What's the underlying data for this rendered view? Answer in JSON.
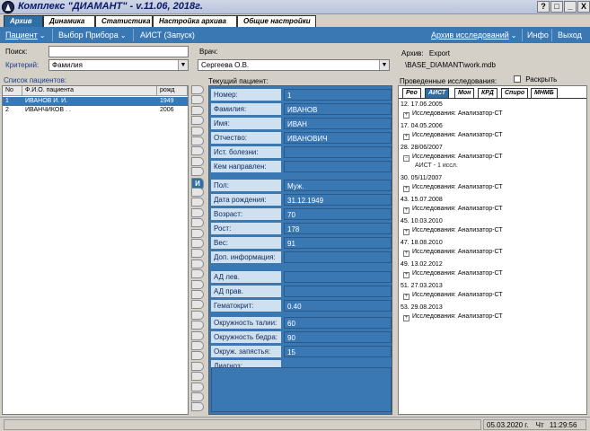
{
  "window": {
    "title": "Комплекс \"ДИАМАНТ\" - v.11.06, 2018г.",
    "buttons": [
      "?",
      "□",
      "_",
      "X"
    ]
  },
  "tabs": [
    {
      "label": "Архив",
      "active": true
    },
    {
      "label": "Динамика",
      "active": false
    },
    {
      "label": "Статистика",
      "active": false
    },
    {
      "label": "Настройка архива",
      "active": false
    },
    {
      "label": "Общие настройки",
      "active": false
    }
  ],
  "toolbar": {
    "patient_menu": "Пациент",
    "device_select": "Выбор Прибора",
    "aist_launch": "АИСТ (Запуск)",
    "archive_research": "Архив исследований",
    "info": "Инфо",
    "exit": "Выход"
  },
  "search": {
    "search_label": "Поиск:",
    "search_value": "",
    "criterion_label": "Критерий:",
    "criterion_value": "Фамилия",
    "doctor_label": "Врач:",
    "doctor_value": "Сергеева О.В.",
    "archive_label": "Архив:",
    "archive_name": "Export",
    "archive_path": "\\BASE_DIAMANT\\work.mdb"
  },
  "patients": {
    "section_label": "Список пациентов:",
    "columns": [
      "No",
      "Ф.И.О. пациента",
      "рожд"
    ],
    "rows": [
      {
        "no": "1",
        "name": "ИВАНОВ И. И.",
        "born": "1949",
        "selected": true
      },
      {
        "no": "2",
        "name": "ИВАНЧИКОВ . .",
        "born": "2006",
        "selected": false
      }
    ]
  },
  "alphabet": {
    "active_letter": "И"
  },
  "current_patient": {
    "section_label": "Текущий пациент:",
    "fields": [
      {
        "label": "Номер:",
        "value": "1"
      },
      {
        "label": "Фамилия:",
        "value": "ИВАНОВ"
      },
      {
        "label": "Имя:",
        "value": "ИВАН"
      },
      {
        "label": "Отчество:",
        "value": "ИВАНОВИЧ"
      },
      {
        "label": "Ист. болезни:",
        "value": ""
      },
      {
        "label": "Кем направлен:",
        "value": ""
      },
      {
        "label": "Пол:",
        "value": "Муж."
      },
      {
        "label": "Дата рождения:",
        "value": "31.12.1949"
      },
      {
        "label": "Возраст:",
        "value": "70"
      },
      {
        "label": "Рост:",
        "value": "178"
      },
      {
        "label": "Вес:",
        "value": "91"
      },
      {
        "label": "Доп. информация:",
        "value": ""
      },
      {
        "label": "АД лев.",
        "value": ""
      },
      {
        "label": "АД прав.",
        "value": ""
      },
      {
        "label": "Гематокрит:",
        "value": "0.40"
      },
      {
        "label": "Окружность талии:",
        "value": "60"
      },
      {
        "label": "Окружность бедра:",
        "value": "90"
      },
      {
        "label": "Окруж. запястья:",
        "value": "15"
      },
      {
        "label": "Диагноз:",
        "value": ""
      }
    ]
  },
  "research": {
    "section_label": "Проведенные исследования:",
    "expand_label": "Раскрыть",
    "tabs": [
      {
        "label": "Рео",
        "active": false
      },
      {
        "label": "АИСТ",
        "active": true
      },
      {
        "label": "Мон",
        "active": false
      },
      {
        "label": "КРД",
        "active": false
      },
      {
        "label": "Спиро",
        "active": false
      },
      {
        "label": "МНМБ",
        "active": false
      }
    ],
    "entries": [
      {
        "date": "12. 17.06.2005",
        "item": "Исследования: Анализатор-СТ",
        "sub": ""
      },
      {
        "date": "17. 04.05.2006",
        "item": "Исследования: Анализатор-СТ",
        "sub": ""
      },
      {
        "date": "28. 28/06/2007",
        "item": "Исследования: Анализатор-СТ",
        "sub": "АИСТ - 1 иссл."
      },
      {
        "date": "30. 05/11/2007",
        "item": "Исследования: Анализатор-СТ",
        "sub": ""
      },
      {
        "date": "43. 15.07.2008",
        "item": "Исследования: Анализатор-СТ",
        "sub": ""
      },
      {
        "date": "45. 10.03.2010",
        "item": "Исследования: Анализатор-СТ",
        "sub": ""
      },
      {
        "date": "47. 18.08.2010",
        "item": "Исследования: Анализатор-СТ",
        "sub": ""
      },
      {
        "date": "49. 13.02.2012",
        "item": "Исследования: Анализатор-СТ",
        "sub": ""
      },
      {
        "date": "51. 27.03.2013",
        "item": "Исследования: Анализатор-СТ",
        "sub": ""
      },
      {
        "date": "53. 29.08.2013",
        "item": "Исследования: Анализатор-СТ",
        "sub": ""
      }
    ]
  },
  "status": {
    "date": "05.03.2020 г.",
    "weekday": "Чт",
    "time": "11:29:56"
  }
}
